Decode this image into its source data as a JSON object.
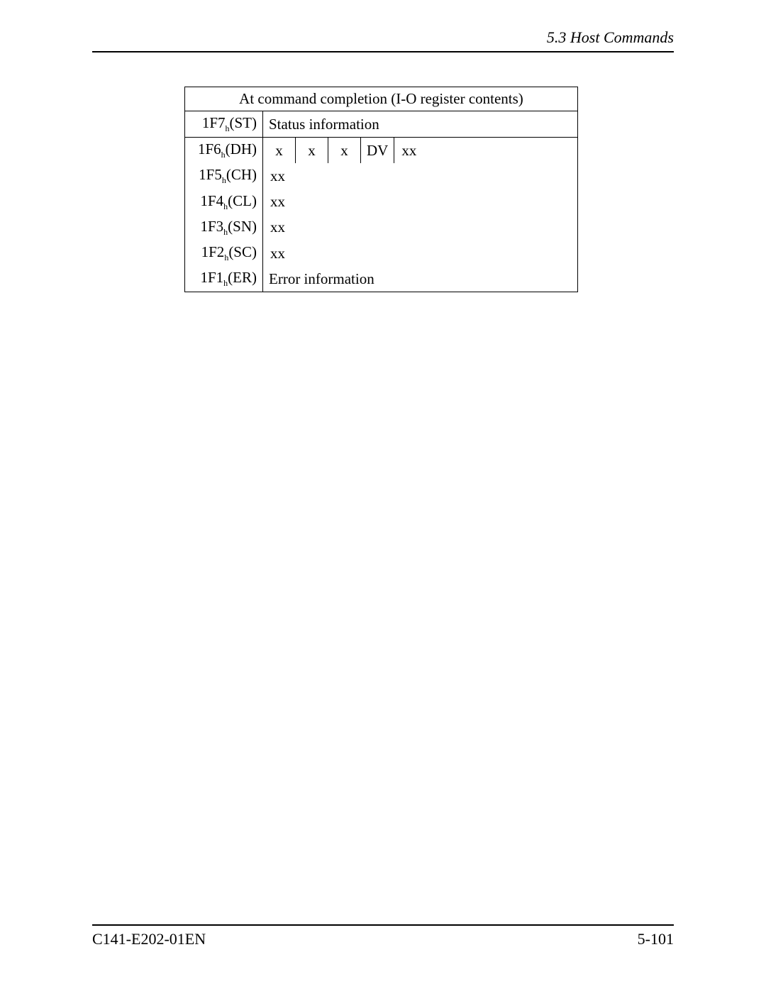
{
  "header": {
    "section": "5.3  Host Commands"
  },
  "table": {
    "title": "At command completion (I-O register contents)",
    "rows": {
      "st": {
        "reg": "1F7",
        "sub": "h",
        "name": "(ST)",
        "value": "Status information"
      },
      "dh": {
        "reg": "1F6",
        "sub": "h",
        "name": "(DH)",
        "c0": "x",
        "c1": "x",
        "c2": "x",
        "c3": "DV",
        "c4": "xx"
      },
      "ch": {
        "reg": "1F5",
        "sub": "h",
        "name": "(CH)",
        "value": "xx"
      },
      "cl": {
        "reg": "1F4",
        "sub": "h",
        "name": "(CL)",
        "value": "xx"
      },
      "sn": {
        "reg": "1F3",
        "sub": "h",
        "name": "(SN)",
        "value": "xx"
      },
      "sc": {
        "reg": "1F2",
        "sub": "h",
        "name": "(SC)",
        "value": "xx"
      },
      "er": {
        "reg": "1F1",
        "sub": "h",
        "name": "(ER)",
        "value": "Error information"
      }
    }
  },
  "footer": {
    "docnum": "C141-E202-01EN",
    "pagenum": "5-101"
  }
}
